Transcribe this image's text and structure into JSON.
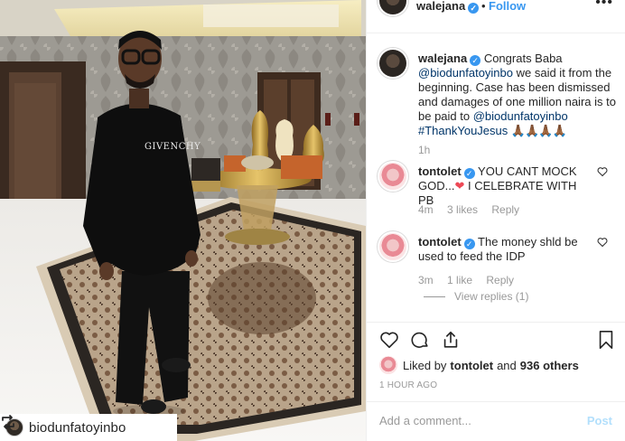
{
  "photo": {
    "shirt_text": "GIVENCHY",
    "repost_user": "biodunfatoyinbo"
  },
  "header": {
    "username": "walejana",
    "separator": "•",
    "follow_label": "Follow",
    "more_label": "•••"
  },
  "caption": {
    "username": "walejana",
    "text_1": " Congrats Baba ",
    "mention_1": "@biodunfatoyinbo",
    "text_2": " we said it from the beginning. Case has been dismissed and damages of one million naira is to be paid to ",
    "mention_2": "@biodunfatoyinbo",
    "hashtag": "#ThankYouJesus",
    "emoji": "🙏🏾🙏🏾🙏🏾🙏🏾",
    "time": "1h"
  },
  "comments": [
    {
      "username": "tontolet",
      "text_1": " YOU CANT MOCK GOD...",
      "heart": "❤",
      "text_2": " I CELEBRATE WITH PB",
      "time": "4m",
      "likes": "3 likes",
      "reply": "Reply"
    },
    {
      "username": "tontolet",
      "text_1": " The money shld be used to feed the IDP",
      "time": "3m",
      "likes": "1 like",
      "reply": "Reply",
      "view_replies": "View replies (1)"
    }
  ],
  "likes": {
    "prefix": "Liked by ",
    "user": "tontolet",
    "middle": " and ",
    "others": "936 others"
  },
  "timestamp": "1 HOUR AGO",
  "add_comment": {
    "placeholder": "Add a comment...",
    "post_label": "Post"
  },
  "colors": {
    "link_blue": "#3897f0",
    "mention": "#003569",
    "muted": "#999999",
    "heart_red": "#ed4956"
  }
}
